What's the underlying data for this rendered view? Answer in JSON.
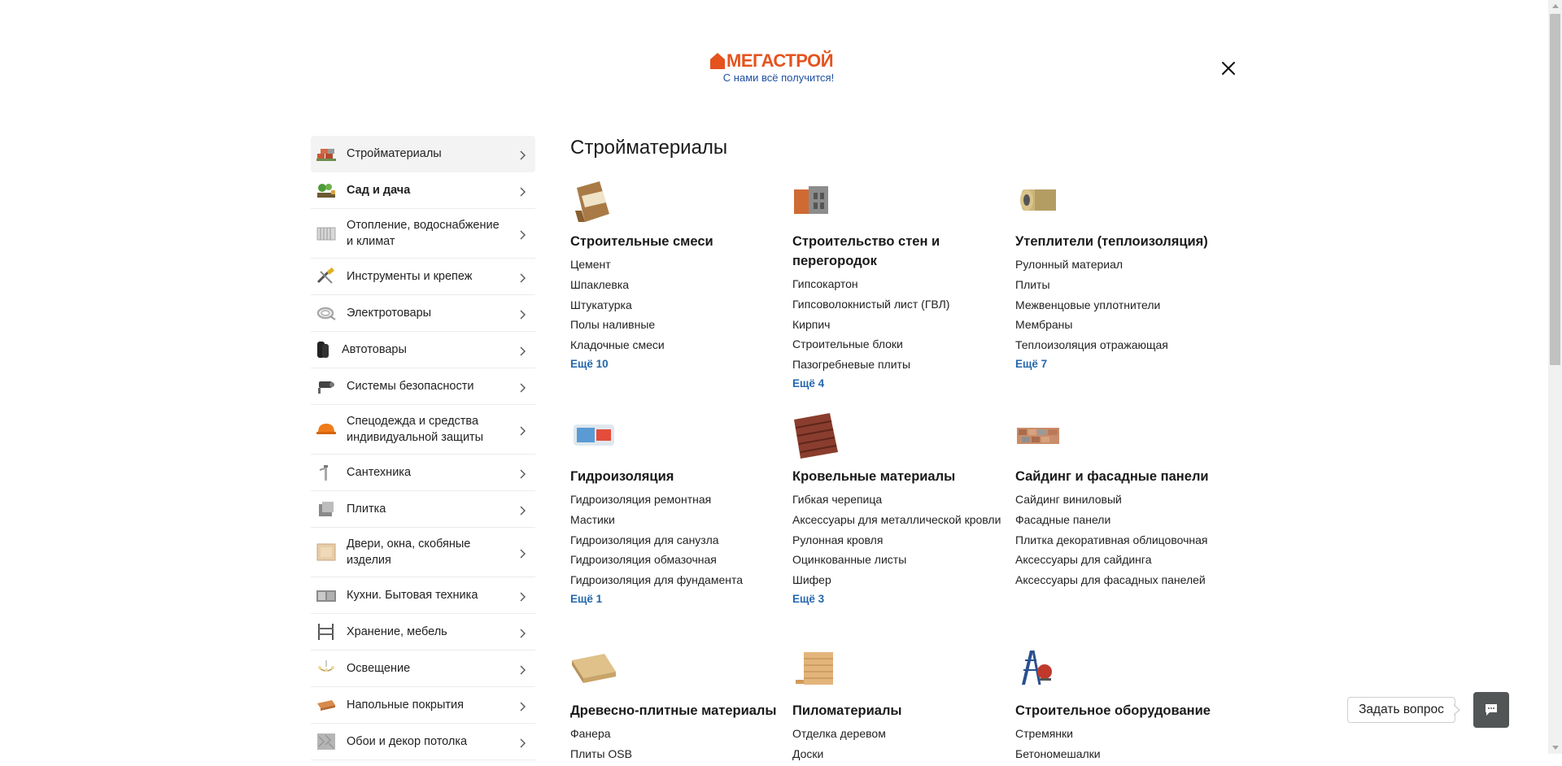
{
  "header": {
    "logo_name": "МЕГАСТРОЙ",
    "logo_slogan": "С нами всё получится!",
    "close_icon": "close-icon"
  },
  "colors": {
    "brand_orange": "#e5531f",
    "brand_blue": "#1f4fa0",
    "link_blue": "#2467ac",
    "active_bg": "#f3f3f3",
    "chat_button": "#535657"
  },
  "sidebar": {
    "items": [
      {
        "label": "Стройматериалы",
        "icon": "bricks-icon"
      },
      {
        "label": "Сад и дача",
        "icon": "garden-icon"
      },
      {
        "label": "Отопление, водоснабжение и климат",
        "icon": "radiator-icon"
      },
      {
        "label": "Инструменты и крепеж",
        "icon": "tools-icon"
      },
      {
        "label": "Электротовары",
        "icon": "cable-icon"
      },
      {
        "label": "Автотовары",
        "icon": "tires-icon"
      },
      {
        "label": "Системы безопасности",
        "icon": "camera-icon"
      },
      {
        "label": "Спецодежда и средства индивидуальной защиты",
        "icon": "helmet-icon"
      },
      {
        "label": "Сантехника",
        "icon": "faucet-icon"
      },
      {
        "label": "Плитка",
        "icon": "tile-icon"
      },
      {
        "label": "Двери, окна, скобяные изделия",
        "icon": "door-icon"
      },
      {
        "label": "Кухни. Бытовая техника",
        "icon": "kitchen-icon"
      },
      {
        "label": "Хранение, мебель",
        "icon": "shelf-icon"
      },
      {
        "label": "Освещение",
        "icon": "chandelier-icon"
      },
      {
        "label": "Напольные покрытия",
        "icon": "flooring-icon"
      },
      {
        "label": "Обои и декор потолка",
        "icon": "wallpaper-icon"
      }
    ]
  },
  "main": {
    "title": "Стройматериалы",
    "categories": [
      {
        "title": "Строительные смеси",
        "icon": "cement-bag-icon",
        "links": [
          "Цемент",
          "Шпаклевка",
          "Штукатурка",
          "Полы наливные",
          "Кладочные смеси"
        ],
        "more": "Ещё 10"
      },
      {
        "title": "Строительство стен и перегородок",
        "icon": "blocks-icon",
        "links": [
          "Гипсокартон",
          "Гипсоволокнистый лист (ГВЛ)",
          "Кирпич",
          "Строительные блоки",
          "Пазогребневые плиты"
        ],
        "more": "Ещё 4"
      },
      {
        "title": "Утеплители (теплоизоляция)",
        "icon": "insulation-roll-icon",
        "links": [
          "Рулонный материал",
          "Плиты",
          "Межвенцовые уплотнители",
          "Мембраны",
          "Теплоизоляция отражающая"
        ],
        "more": "Ещё 7"
      },
      {
        "title": "Гидроизоляция",
        "icon": "waterproofing-bucket-icon",
        "links": [
          "Гидроизоляция ремонтная",
          "Мастики",
          "Гидроизоляция для санузла",
          "Гидроизоляция обмазочная",
          "Гидроизоляция для фундамента"
        ],
        "more": "Ещё 1"
      },
      {
        "title": "Кровельные материалы",
        "icon": "roof-tile-icon",
        "links": [
          "Гибкая черепица",
          "Аксессуары для металлической кровли",
          "Рулонная кровля",
          "Оцинкованные листы",
          "Шифер"
        ],
        "more": "Ещё 3"
      },
      {
        "title": "Сайдинг и фасадные панели",
        "icon": "facade-panel-icon",
        "links": [
          "Сайдинг виниловый",
          "Фасадные панели",
          "Плитка декоративная облицовочная",
          "Аксессуары для сайдинга",
          "Аксессуары для фасадных панелей"
        ],
        "more": ""
      },
      {
        "title": "Древесно-плитные материалы",
        "icon": "osb-board-icon",
        "links": [
          "Фанера",
          "Плиты OSB"
        ],
        "more": ""
      },
      {
        "title": "Пиломатериалы",
        "icon": "lumber-icon",
        "links": [
          "Отделка деревом",
          "Доски"
        ],
        "more": ""
      },
      {
        "title": "Строительное оборудование",
        "icon": "ladder-mixer-icon",
        "links": [
          "Стремянки",
          "Бетономешалки"
        ],
        "more": ""
      }
    ]
  },
  "chat": {
    "label": "Задать вопрос",
    "icon": "chat-icon"
  }
}
